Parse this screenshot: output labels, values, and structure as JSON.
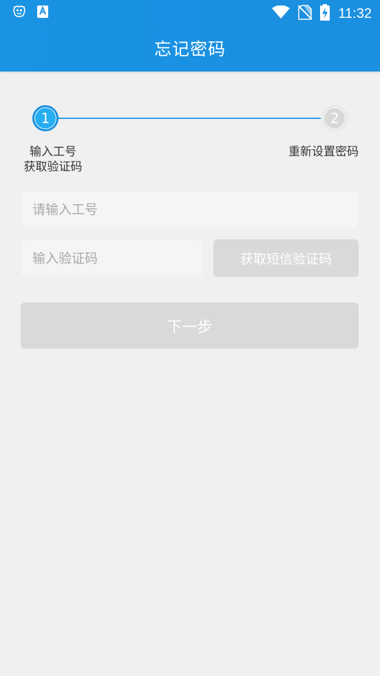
{
  "status_bar": {
    "time": "11:32",
    "icons": [
      "app-notification-icon",
      "keyboard-a-icon",
      "wifi-icon",
      "no-sim-icon",
      "battery-charging-icon"
    ]
  },
  "header": {
    "title": "忘记密码"
  },
  "stepper": {
    "steps": [
      {
        "number": "1",
        "label_line1": "输入工号",
        "label_line2": "获取验证码"
      },
      {
        "number": "2",
        "label_line1": "重新设置密码"
      }
    ],
    "active_color": "#26aef2",
    "inactive_color": "#d8d8d8"
  },
  "form": {
    "employee_id_placeholder": "请输入工号",
    "code_placeholder": "输入验证码",
    "get_sms_label": "获取短信验证码",
    "next_label": "下一步"
  },
  "colors": {
    "header_blue": "#1a93e3",
    "disabled_button": "#d9d9d9",
    "background": "#f0f0f0"
  }
}
